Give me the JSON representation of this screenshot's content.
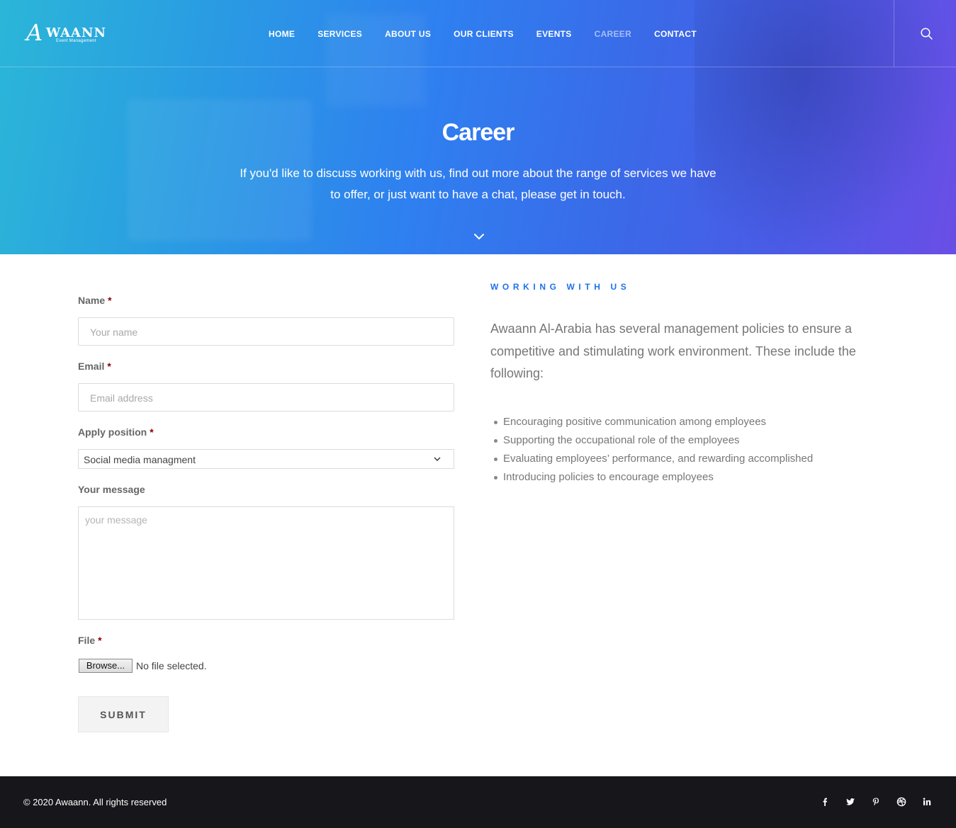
{
  "brand": {
    "logo_mark": "A",
    "logo_word": "WAANN",
    "logo_sub": "Event Management"
  },
  "nav": {
    "items": [
      {
        "label": "HOME"
      },
      {
        "label": "SERVICES"
      },
      {
        "label": "ABOUT US"
      },
      {
        "label": "OUR CLIENTS"
      },
      {
        "label": "EVENTS"
      },
      {
        "label": "CAREER",
        "active": true
      },
      {
        "label": "CONTACT"
      }
    ]
  },
  "hero": {
    "title": "Career",
    "text": "If you'd like to discuss working with us, find out more about the range of services we have to offer, or just want to have a chat, please get in touch."
  },
  "form": {
    "name_label": "Name",
    "name_placeholder": "Your name",
    "email_label": "Email",
    "email_placeholder": "Email address",
    "position_label": "Apply position",
    "position_value": "Social media managment",
    "message_label": "Your message",
    "message_placeholder": "your message",
    "file_label": "File",
    "browse_label": "Browse...",
    "file_status": "No file selected.",
    "required_mark": "*",
    "submit_label": "SUBMIT"
  },
  "working": {
    "heading": "WORKING WITH US",
    "intro": "Awaann Al-Arabia has several management policies to ensure a competitive and stimulating work environment. These include the following:",
    "bullets": [
      "Encouraging positive communication among employees",
      "Supporting the occupational role of the employees",
      "Evaluating employees’ performance, and rewarding accomplished",
      "Introducing policies to encourage employees"
    ]
  },
  "footer": {
    "copyright": "© 2020 Awaann. All rights reserved",
    "social": [
      "facebook-icon",
      "twitter-icon",
      "pinterest-icon",
      "dribbble-icon",
      "linkedin-icon"
    ]
  },
  "colors": {
    "accent": "#1e73e8",
    "required": "#8b0000",
    "footer_bg": "#16161b"
  }
}
